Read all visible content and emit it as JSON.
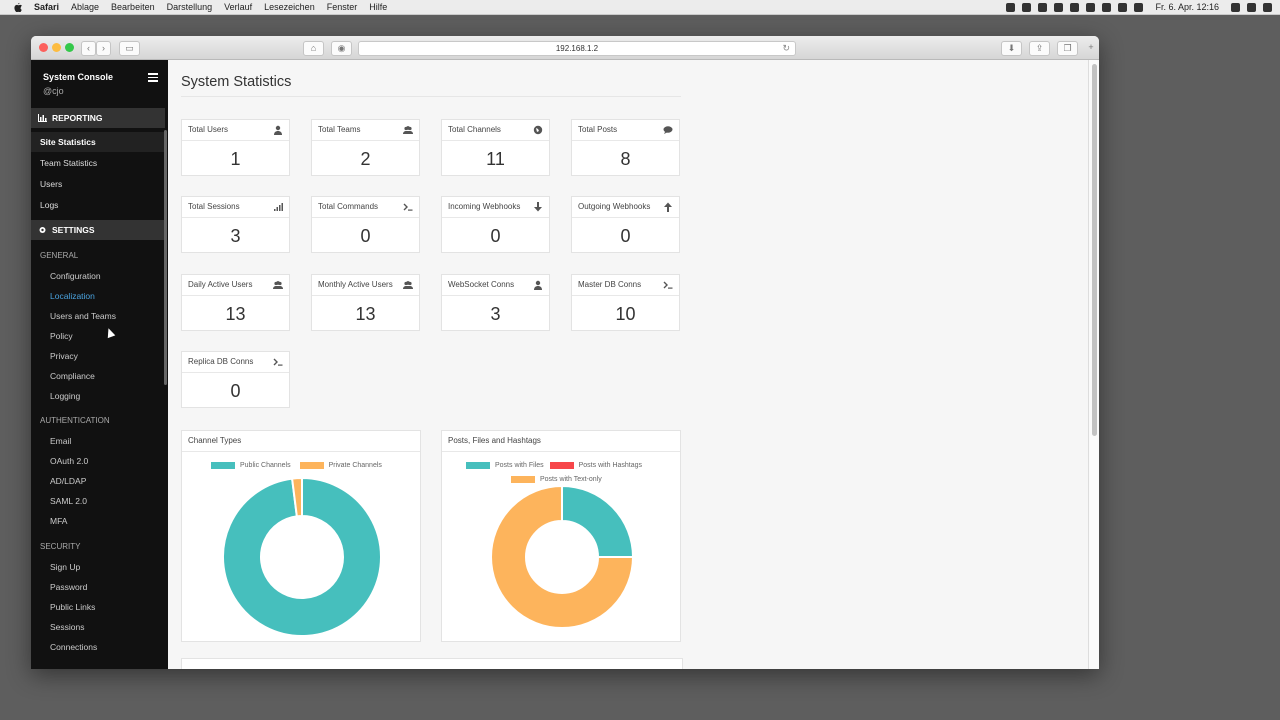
{
  "menubar": {
    "app": "Safari",
    "items": [
      "Ablage",
      "Bearbeiten",
      "Darstellung",
      "Verlauf",
      "Lesezeichen",
      "Fenster",
      "Hilfe"
    ],
    "clock": "Fr. 6. Apr. 12:16"
  },
  "browser": {
    "url": "192.168.1.2"
  },
  "sidebar": {
    "title": "System Console",
    "user": "@cjo",
    "reporting_header": "REPORTING",
    "reporting_items": [
      "Site Statistics",
      "Team Statistics",
      "Users",
      "Logs"
    ],
    "settings_header": "SETTINGS",
    "groups": [
      {
        "label": "GENERAL",
        "items": [
          "Configuration",
          "Localization",
          "Users and Teams",
          "Policy",
          "Privacy",
          "Compliance",
          "Logging"
        ]
      },
      {
        "label": "AUTHENTICATION",
        "items": [
          "Email",
          "OAuth 2.0",
          "AD/LDAP",
          "SAML 2.0",
          "MFA"
        ]
      },
      {
        "label": "SECURITY",
        "items": [
          "Sign Up",
          "Password",
          "Public Links",
          "Sessions",
          "Connections"
        ]
      }
    ]
  },
  "main": {
    "title": "System Statistics",
    "stats": [
      {
        "label": "Total Users",
        "value": "1",
        "icon": "user-icon"
      },
      {
        "label": "Total Teams",
        "value": "2",
        "icon": "users-icon"
      },
      {
        "label": "Total Channels",
        "value": "11",
        "icon": "globe-icon"
      },
      {
        "label": "Total Posts",
        "value": "8",
        "icon": "comment-icon"
      },
      {
        "label": "Total Sessions",
        "value": "3",
        "icon": "signal-icon"
      },
      {
        "label": "Total Commands",
        "value": "0",
        "icon": "terminal-icon"
      },
      {
        "label": "Incoming Webhooks",
        "value": "0",
        "icon": "arrow-down-icon"
      },
      {
        "label": "Outgoing Webhooks",
        "value": "0",
        "icon": "arrow-up-icon"
      },
      {
        "label": "Daily Active Users",
        "value": "13",
        "icon": "users-icon"
      },
      {
        "label": "Monthly Active Users",
        "value": "13",
        "icon": "users-icon"
      },
      {
        "label": "WebSocket Conns",
        "value": "3",
        "icon": "user-icon"
      },
      {
        "label": "Master DB Conns",
        "value": "10",
        "icon": "terminal-icon"
      },
      {
        "label": "Replica DB Conns",
        "value": "0",
        "icon": "terminal-icon"
      }
    ],
    "charts": [
      {
        "title": "Channel Types",
        "legend": [
          {
            "name": "Public Channels",
            "color": "#46bfbd"
          },
          {
            "name": "Private Channels",
            "color": "#fdb45c"
          }
        ]
      },
      {
        "title": "Posts, Files and Hashtags",
        "legend": [
          {
            "name": "Posts with Files",
            "color": "#46bfbd"
          },
          {
            "name": "Posts with Hashtags",
            "color": "#f7464a"
          },
          {
            "name": "Posts with Text-only",
            "color": "#fdb45c"
          }
        ]
      }
    ]
  },
  "chart_data": [
    {
      "type": "pie",
      "title": "Channel Types",
      "categories": [
        "Public Channels",
        "Private Channels"
      ],
      "values": [
        98,
        2
      ],
      "colors": [
        "#46bfbd",
        "#fdb45c"
      ]
    },
    {
      "type": "pie",
      "title": "Posts, Files and Hashtags",
      "categories": [
        "Posts with Files",
        "Posts with Hashtags",
        "Posts with Text-only"
      ],
      "values": [
        2,
        0,
        6
      ],
      "colors": [
        "#46bfbd",
        "#f7464a",
        "#fdb45c"
      ]
    }
  ]
}
